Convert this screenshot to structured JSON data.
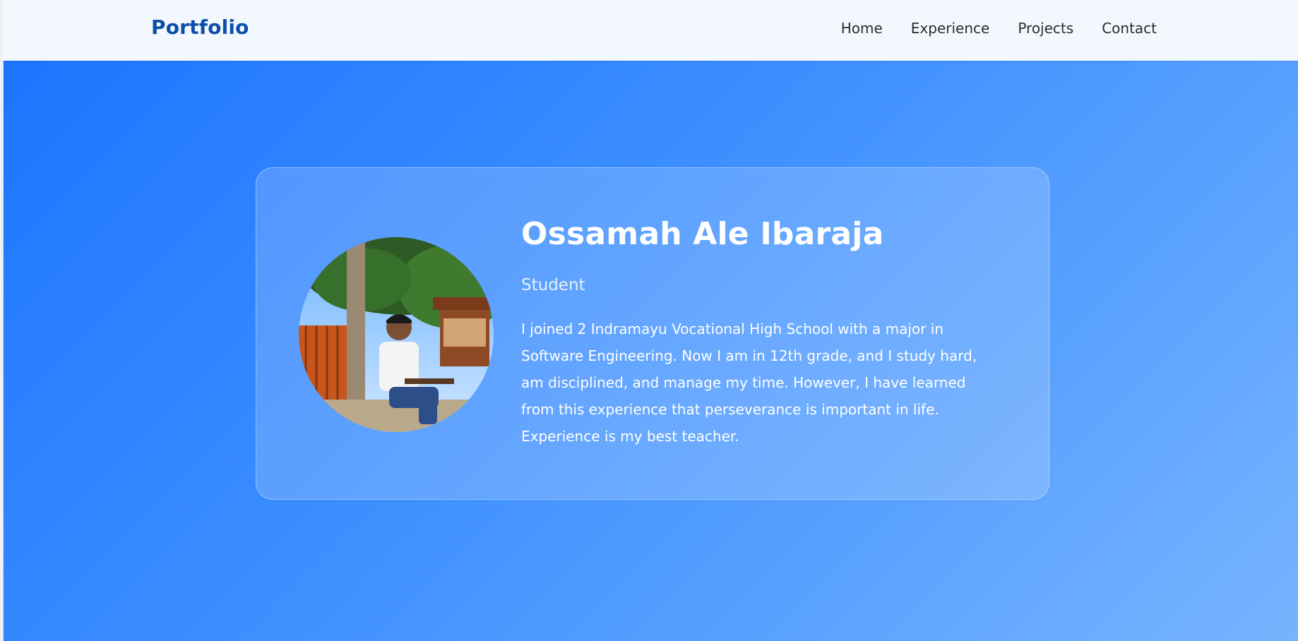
{
  "nav": {
    "brand": "Portfolio",
    "links": [
      "Home",
      "Experience",
      "Projects",
      "Contact"
    ]
  },
  "profile": {
    "name": "Ossamah Ale Ibaraja",
    "role": "Student",
    "bio": "I joined 2 Indramayu Vocational High School with a major in Software Engineering. Now I am in 12th grade, and I study hard, am disciplined, and manage my time. However, I have learned from this experience that perseverance is important in life. Experience is my best teacher."
  },
  "colors": {
    "brand": "#0d4fa8",
    "gradient_start": "#1a73ff",
    "gradient_end": "#77b4ff"
  }
}
